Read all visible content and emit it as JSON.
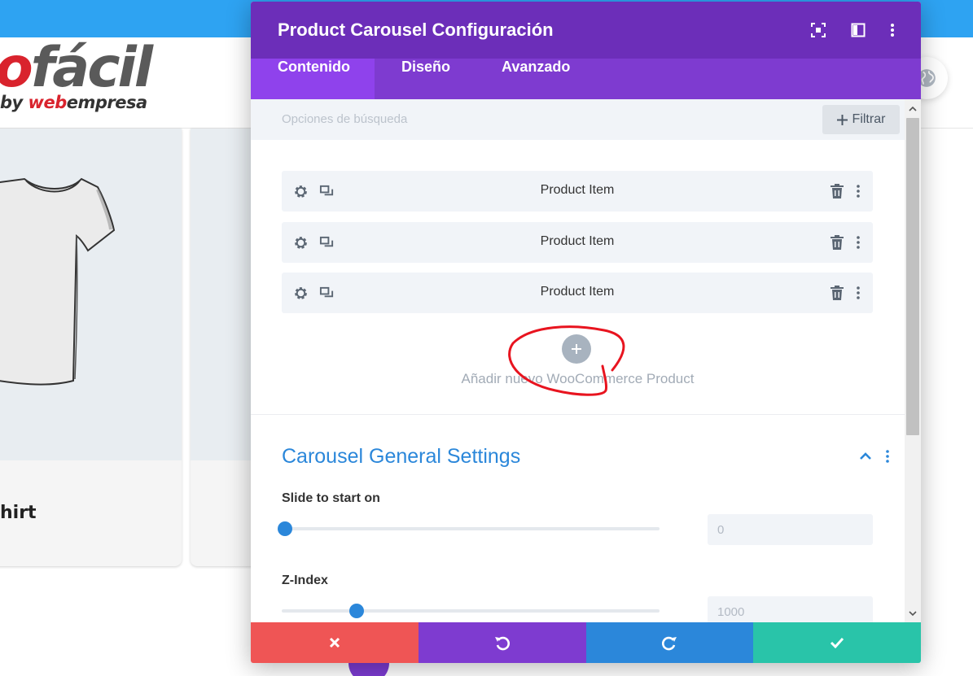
{
  "background": {
    "logo_main_red": "o",
    "logo_main_gray": "fácil",
    "logo_sub_by": "by ",
    "logo_sub_web": "web",
    "logo_sub_empresa": "empresa",
    "card_title": "hirt"
  },
  "modal": {
    "title": "Product Carousel Configuración",
    "tabs": [
      {
        "label": "Contenido",
        "active": true
      },
      {
        "label": "Diseño",
        "active": false
      },
      {
        "label": "Avanzado",
        "active": false
      }
    ],
    "search_placeholder": "Opciones de búsqueda",
    "filter_label": "Filtrar",
    "items": [
      {
        "label": "Product Item"
      },
      {
        "label": "Product Item"
      },
      {
        "label": "Product Item"
      }
    ],
    "add_label": "Añadir nuevo WooCommerce Product",
    "section_title": "Carousel General Settings",
    "fields": [
      {
        "label": "Slide to start on",
        "value": "0",
        "slider_fraction": 0.0
      },
      {
        "label": "Z-Index",
        "value": "1000",
        "slider_fraction": 0.19
      }
    ]
  },
  "colors": {
    "header_purple": "#6c2eb9",
    "tab_bar_purple": "#7e3bd0",
    "active_tab": "#8f42ec",
    "accent_blue": "#2b87da",
    "cancel_red": "#ef5555",
    "save_green": "#29c4a9",
    "annotation_red": "#e8141f"
  }
}
